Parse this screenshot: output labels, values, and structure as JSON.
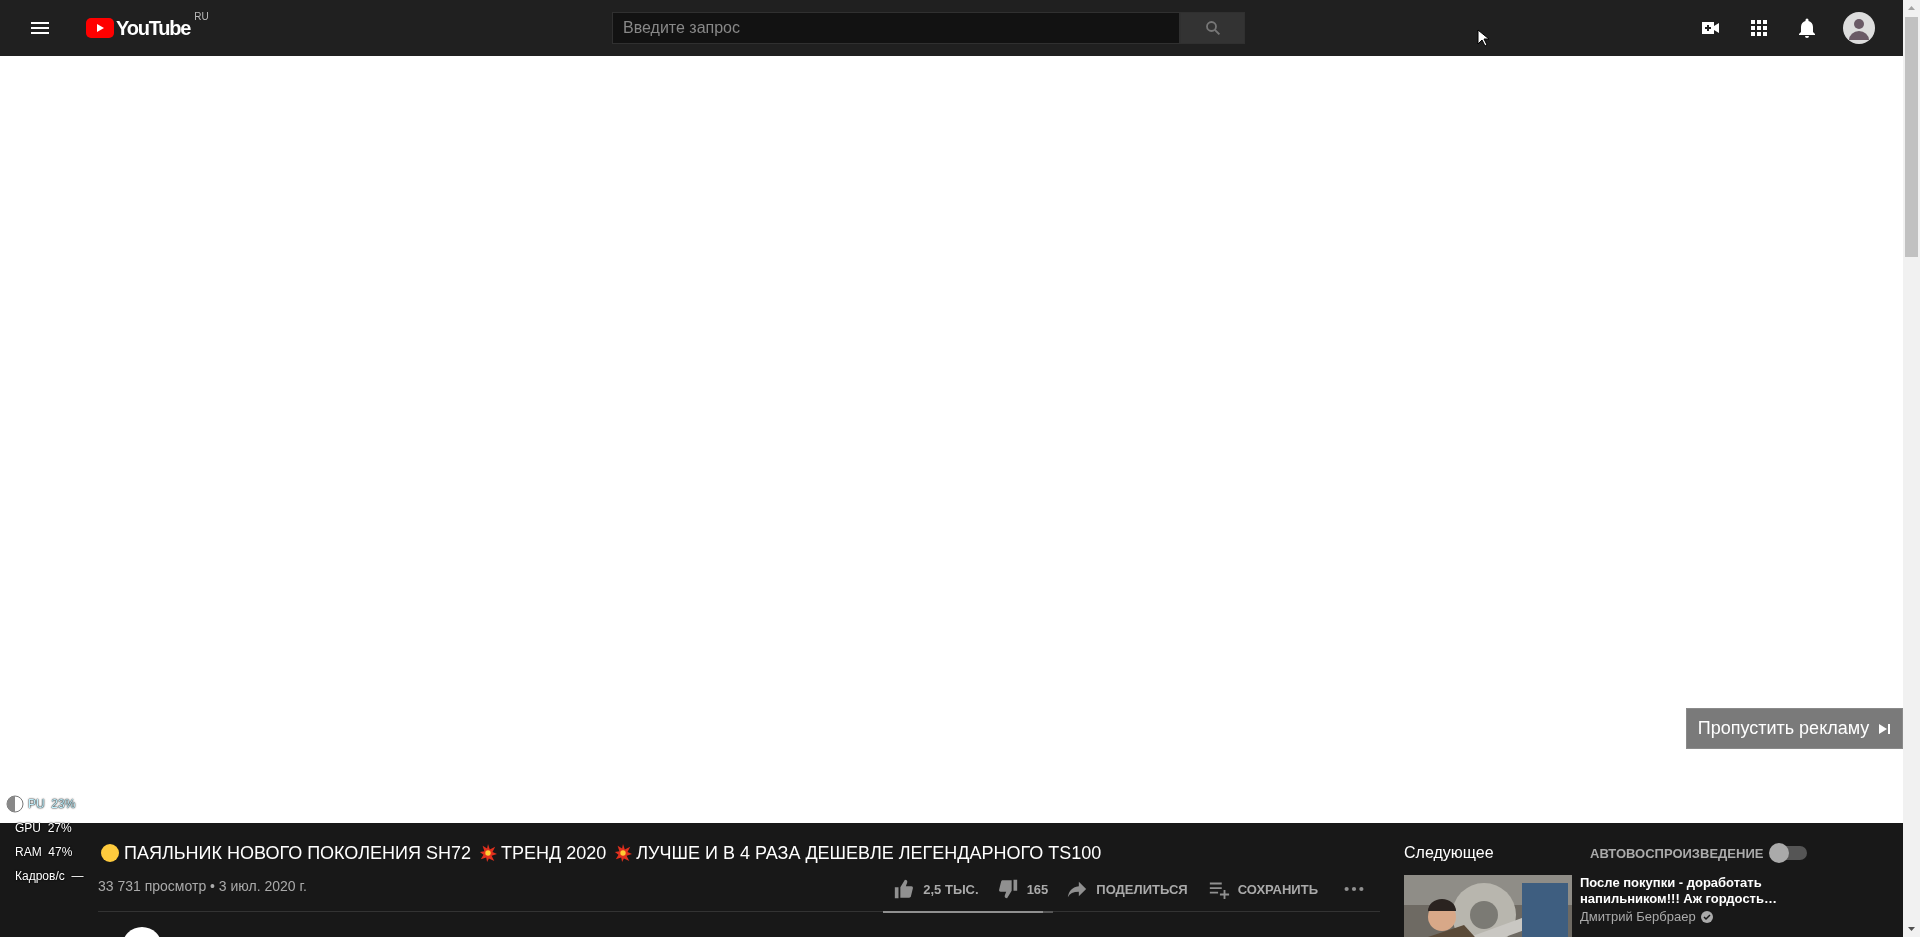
{
  "masthead": {
    "logo_text": "YouTube",
    "country_code": "RU",
    "search": {
      "placeholder": "Введите запрос"
    }
  },
  "ad": {
    "skip_label": "Пропустить рекламу"
  },
  "perf_overlay": [
    {
      "label": "PU",
      "value": "23%"
    },
    {
      "label": "GPU",
      "value": "27%"
    },
    {
      "label": "RAM",
      "value": "47%"
    },
    {
      "label": "Кадров/с",
      "value": "—"
    }
  ],
  "video": {
    "title_parts": [
      {
        "kind": "emoji"
      },
      {
        "kind": "text",
        "text": "ПАЯЛЬНИК НОВОГО ПОКОЛЕНИЯ SH72"
      },
      {
        "kind": "burst"
      },
      {
        "kind": "text",
        "text": "ТРЕНД 2020"
      },
      {
        "kind": "burst"
      },
      {
        "kind": "text",
        "text": "ЛУЧШЕ И В 4 РАЗА ДЕШЕВЛЕ ЛЕГЕНДАРНОГО TS100"
      }
    ],
    "views": "33 731 просмотр",
    "separator": "•",
    "date": "3 июл. 2020 г.",
    "actions": [
      {
        "kind": "like",
        "label": "2,5 ТЫС."
      },
      {
        "kind": "dislike",
        "label": "165"
      },
      {
        "kind": "share",
        "label": "ПОДЕЛИТЬСЯ"
      },
      {
        "kind": "save",
        "label": "СОХРАНИТЬ"
      },
      {
        "kind": "more"
      }
    ],
    "sentiment": {
      "level": 0.94
    }
  },
  "up_next": {
    "heading": "Следующее",
    "autoplay_label": "АВТОВОСПРОИЗВЕДЕНИЕ",
    "autoplay_on": false,
    "items": [
      {
        "title": "После покупки - доработать напильником!!! Аж гордость…",
        "channel": "Дмитрий Бербраер",
        "verified": true
      }
    ]
  }
}
